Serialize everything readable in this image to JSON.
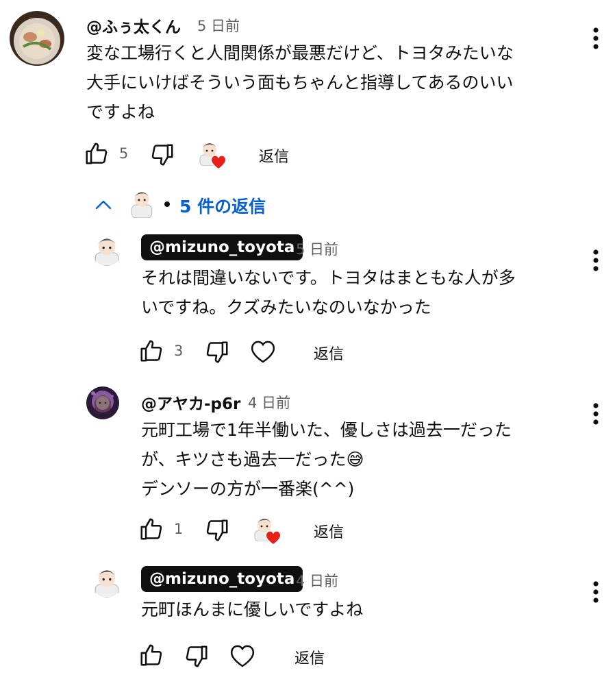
{
  "comments": {
    "main": {
      "handle": "@ふぅ太くん",
      "time": "5 日前",
      "text": "変な工場行くと人間関係が最悪だけど、トヨタみたいな\n大手にいけばそういう面もちゃんと指導してあるのいい\nですよね",
      "likes": "5",
      "reply_label": "返信"
    },
    "replies_toggle": {
      "label": "5 件の返信"
    },
    "reply1": {
      "handle": "@mizuno_toyota",
      "time": "5 日前",
      "text": "それは間違いないです。トヨタはまともな人が多\nいですね。クズみたいなのいなかった",
      "likes": "3",
      "reply_label": "返信"
    },
    "reply2": {
      "handle": "@アヤカ-p6r",
      "time": "4 日前",
      "text": "元町工場で1年半働いた、優しさは過去一だった\nが、キツさも過去一だった😅\nデンソーの方が一番楽(^^)",
      "likes": "1",
      "reply_label": "返信"
    },
    "reply3": {
      "handle": "@mizuno_toyota",
      "time": "4 日前",
      "text": "元町ほんまに優しいですよね",
      "reply_label": "返信"
    }
  },
  "colors": {
    "link_blue": "#065fd4",
    "chip_bg": "#0f0f0f",
    "secondary_text": "#606060",
    "heart_red": "#e62117"
  }
}
